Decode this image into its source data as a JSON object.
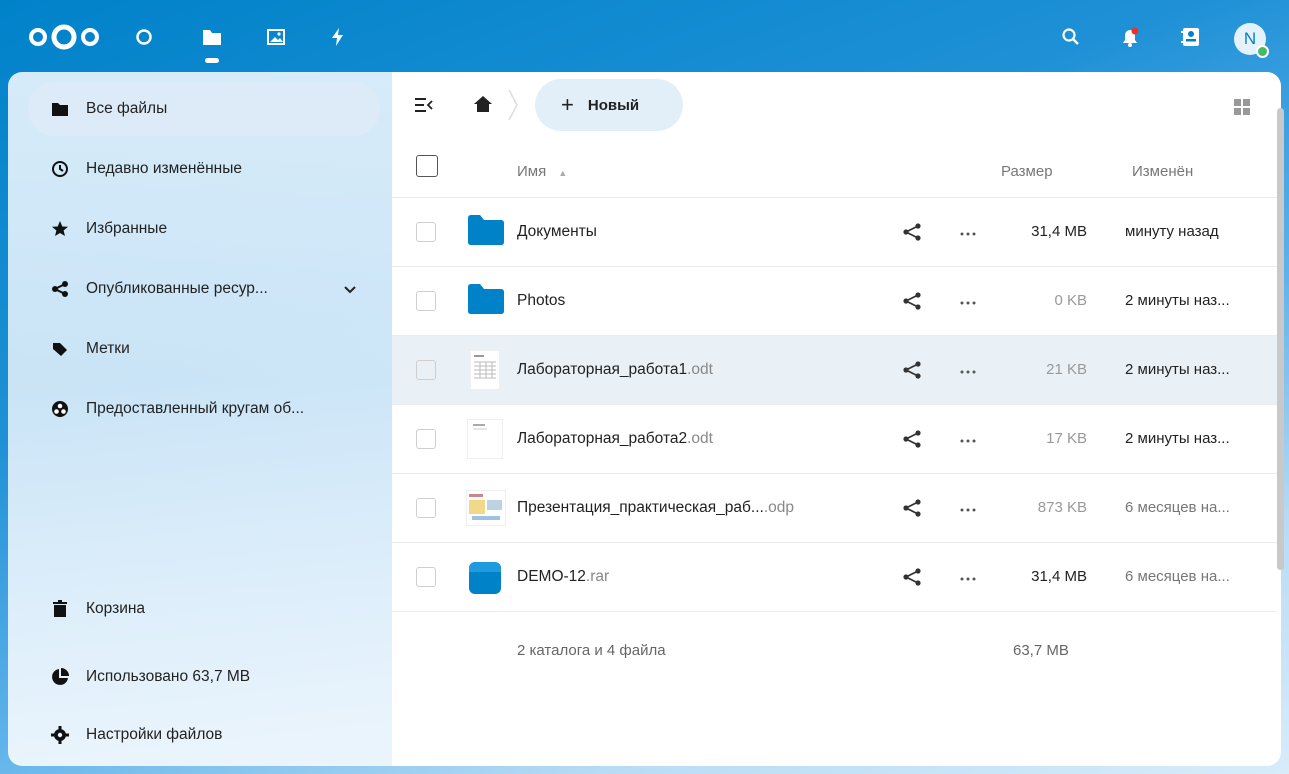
{
  "header": {
    "apps": [
      "dashboard-icon",
      "files-icon",
      "photos-icon",
      "activity-icon"
    ],
    "avatar_initial": "N"
  },
  "sidebar": {
    "items": [
      {
        "label": "Все файлы",
        "icon": "folder-icon",
        "active": true
      },
      {
        "label": "Недавно изменённые",
        "icon": "clock-icon"
      },
      {
        "label": "Избранные",
        "icon": "star-icon"
      },
      {
        "label": "Опубликованные ресур...",
        "icon": "share-icon",
        "expandable": true
      },
      {
        "label": "Метки",
        "icon": "tag-icon"
      },
      {
        "label": "Предоставленный кругам об...",
        "icon": "circles-icon"
      }
    ],
    "bottom": [
      {
        "label": "Корзина",
        "icon": "trash-icon"
      },
      {
        "label": "Использовано 63,7 MB",
        "icon": "pie-chart-icon"
      },
      {
        "label": "Настройки файлов",
        "icon": "gear-icon"
      }
    ]
  },
  "toolbar": {
    "new_label": "Новый"
  },
  "table": {
    "columns": {
      "name": "Имя",
      "size": "Размер",
      "modified": "Изменён"
    },
    "rows": [
      {
        "name": "Документы",
        "ext": "",
        "type": "folder",
        "size": "31,4 MB",
        "modified": "минуту назад"
      },
      {
        "name": "Photos",
        "ext": "",
        "type": "folder",
        "size": "0 KB",
        "modified": "2 минуты наз..."
      },
      {
        "name": "Лабораторная_работа1",
        "ext": ".odt",
        "type": "odt",
        "size": "21 KB",
        "modified": "2 минуты наз..."
      },
      {
        "name": "Лабораторная_работа2",
        "ext": ".odt",
        "type": "odt",
        "size": "17 KB",
        "modified": "2 минуты наз..."
      },
      {
        "name": "Презентация_практическая_раб...",
        "ext": ".odp",
        "type": "odp",
        "size": "873 KB",
        "modified": "6 месяцев на..."
      },
      {
        "name": "DEMO-12",
        "ext": ".rar",
        "type": "rar",
        "size": "31,4 MB",
        "modified": "6 месяцев на..."
      }
    ],
    "summary": "2 каталога и 4 файла",
    "summary_size": "63,7 MB"
  },
  "colors": {
    "brand": "#0082c9",
    "highlight_row": "#e9f1f6"
  }
}
